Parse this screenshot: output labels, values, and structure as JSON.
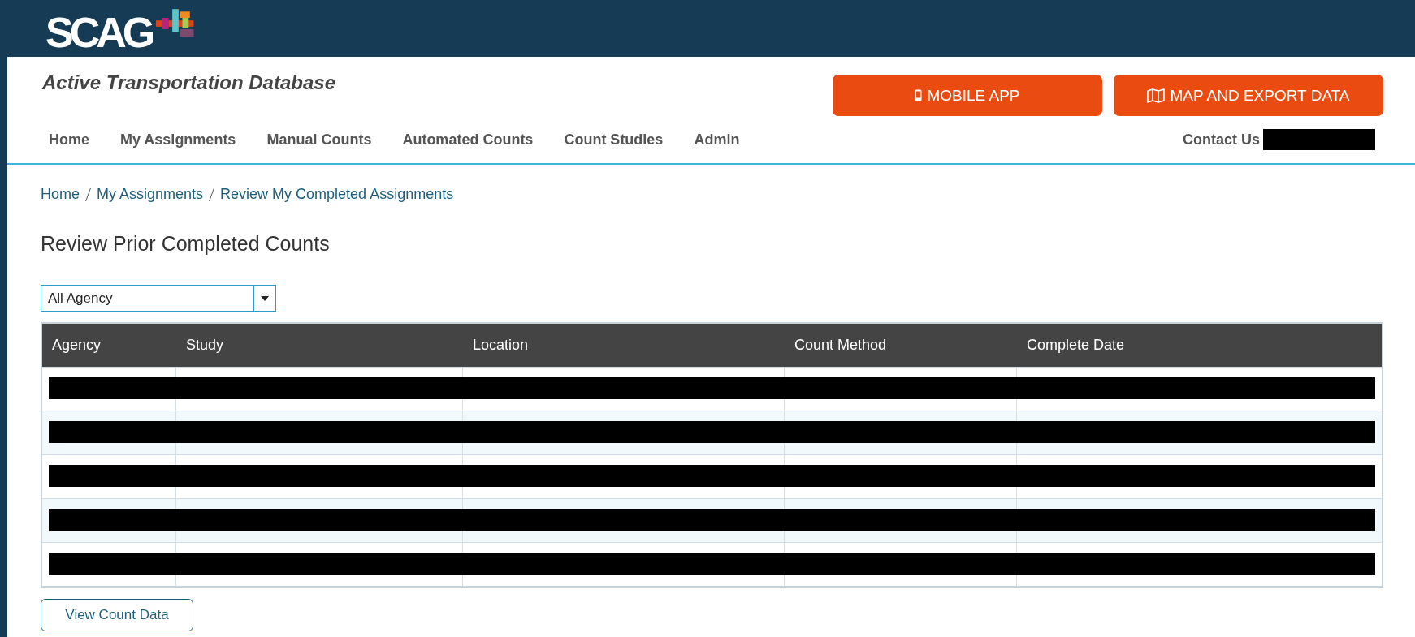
{
  "logo": {
    "text": "SCAG"
  },
  "app_title": "Active Transportation Database",
  "header_buttons": [
    {
      "label": "MOBILE APP",
      "kind": "phone"
    },
    {
      "label": "MAP AND EXPORT DATA",
      "kind": "map"
    }
  ],
  "nav": {
    "items": [
      "Home",
      "My Assignments",
      "Manual Counts",
      "Automated Counts",
      "Count Studies",
      "Admin"
    ],
    "contact": {
      "label": "Contact Us",
      "redacted": true
    }
  },
  "breadcrumb": [
    "Home",
    "My Assignments",
    "Review My Completed Assignments"
  ],
  "heading": "Review Prior Completed Counts",
  "agency_select": {
    "value": "All Agency"
  },
  "table": {
    "columns": [
      "Agency",
      "Study",
      "Location",
      "Count Method",
      "Complete Date"
    ],
    "rows": [
      {
        "kind": "redacted"
      },
      {
        "kind": "redacted"
      },
      {
        "kind": "redacted"
      },
      {
        "kind": "redacted"
      },
      {
        "kind": "redacted"
      }
    ]
  },
  "action_button": "View Count Data"
}
